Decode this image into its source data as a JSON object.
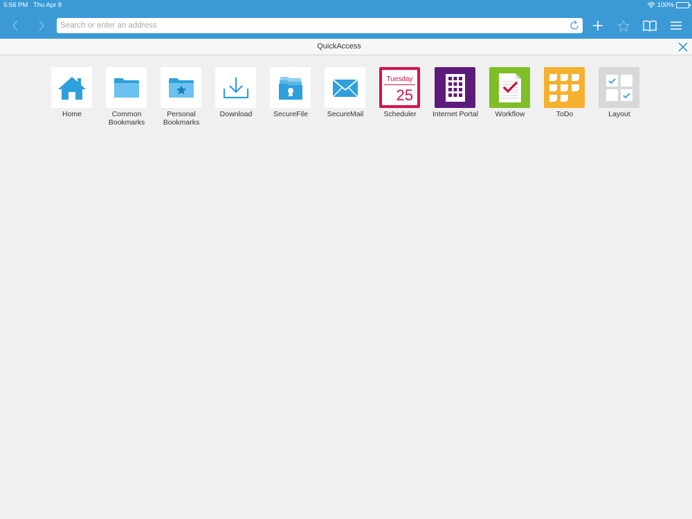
{
  "status": {
    "time": "5:56 PM",
    "date": "Thu Apr 8",
    "battery": "100%",
    "battery_level": 1.0
  },
  "toolbar": {
    "address_placeholder": "Search or enter an address",
    "address_value": ""
  },
  "quickaccess": {
    "title": "QuickAccess"
  },
  "tiles": [
    {
      "label": "Home",
      "icon": "home-icon"
    },
    {
      "label": "Common\nBookmarks",
      "icon": "folder-icon"
    },
    {
      "label": "Personal\nBookmarks",
      "icon": "folder-star-icon"
    },
    {
      "label": "Download",
      "icon": "download-icon"
    },
    {
      "label": "SecureFile",
      "icon": "secure-file-icon"
    },
    {
      "label": "SecureMail",
      "icon": "secure-mail-icon"
    },
    {
      "label": "Scheduler",
      "icon": "calendar-icon",
      "day": "Tuesday",
      "date": "25",
      "color": "#d3124e"
    },
    {
      "label": "Internet Portal",
      "icon": "building-icon",
      "color": "#5e1a7a"
    },
    {
      "label": "Workflow",
      "icon": "checklist-icon",
      "color": "#7fbe25"
    },
    {
      "label": "ToDo",
      "icon": "sticky-notes-icon",
      "color": "#f4b02e"
    },
    {
      "label": "Layout",
      "icon": "layout-icon",
      "color": "#d8d8d8"
    }
  ],
  "colors": {
    "toolbar": "#3b9ad6",
    "accent_blue": "#2ea0dc"
  }
}
